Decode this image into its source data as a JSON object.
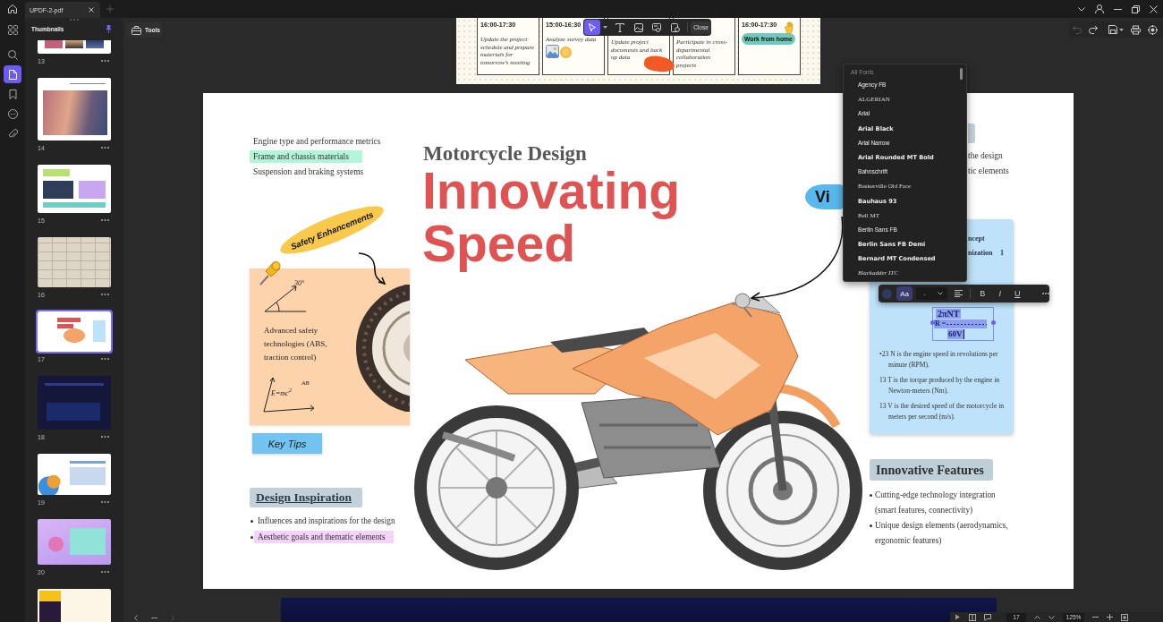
{
  "title_bar": {
    "tabs": [
      {
        "label": "UPDF-2-pdf",
        "selected": true
      }
    ]
  },
  "nav_rail": {
    "items": [
      {
        "selected": false
      },
      {
        "selected": false
      },
      {
        "selected": true
      },
      {
        "selected": false
      },
      {
        "selected": false
      },
      {
        "selected": false
      }
    ]
  },
  "thumbnails": {
    "title": "Thumbnails",
    "pinned": true,
    "pages": [
      {
        "number": "13",
        "selected": false
      },
      {
        "number": "14",
        "selected": false
      },
      {
        "number": "15",
        "selected": false
      },
      {
        "number": "16",
        "selected": false
      },
      {
        "number": "17",
        "selected": true
      },
      {
        "number": "18",
        "selected": false
      },
      {
        "number": "19",
        "selected": false
      },
      {
        "number": "20",
        "selected": false
      },
      {
        "selected": false
      }
    ]
  },
  "tools_button": {
    "label": "Tools"
  },
  "edit_toolbar": {
    "tools": [
      {
        "selected": true
      },
      {
        "selected": false
      },
      {
        "selected": false
      },
      {
        "selected": false
      },
      {
        "selected": false
      }
    ],
    "close": "Close"
  },
  "previous_page": {
    "cards": [
      {
        "time": "16:00-17:30",
        "text": "Update the project schedule and prepare materials for tomorrow's meeting"
      },
      {
        "time": "15:00-16:30",
        "text": "Analyze survey data"
      },
      {
        "text": "Update project documents and back up data"
      },
      {
        "text": "Participate in cross-departmental collaboration projects"
      },
      {
        "time": "16:00-17:30",
        "badge": "Work from home"
      }
    ]
  },
  "page": {
    "topics": [
      {
        "text": "Engine type and performance metrics",
        "highlighted": false
      },
      {
        "text": "Frame and chassis materials",
        "highlighted": true
      },
      {
        "text": "Suspension and braking systems",
        "highlighted": false
      }
    ],
    "subtitle": "Motorcycle Design",
    "title": [
      "Innovating",
      "Speed"
    ],
    "sticker": "Safety Enhancements",
    "note_card": {
      "angle": "30°",
      "text": "Advanced safety technologies (ABS, traction control)",
      "formula": "E=mc$^{2}$",
      "formula_note": "AB"
    },
    "tips_label": "Key Tips",
    "inspiration": {
      "heading": "Design Inspiration",
      "items": [
        {
          "text": "Influences and inspirations for the design",
          "highlighted": false
        },
        {
          "text": "Aesthetic goals and thematic elements",
          "highlighted": true
        }
      ]
    },
    "visual_sticker": "Vi",
    "right_column": {
      "lines": [
        "the design",
        "tic elements"
      ]
    },
    "formula_card": {
      "lines": [
        "ncept",
        "nization"
      ],
      "mark": "1",
      "equation": {
        "numerator": "2πNT",
        "lhs": "R =",
        "denominator": "60V"
      },
      "notes": [
        "•23 N is the engine speed in revolutions per minute (RPM).",
        "13 T is the torque produced by the engine in Newton-meters (Nm).",
        "13 V is the desired speed of the motorcycle in meters per second (m/s)."
      ]
    },
    "features": {
      "heading": "Innovative Features",
      "items": [
        "Cutting-edge technology integration (smart features, connectivity)",
        "Unique design elements (aerodynamics, ergonomic features)"
      ]
    }
  },
  "font_menu": {
    "header": "All Fonts",
    "fonts": [
      {
        "name": "Agency FB",
        "kind": "narrow"
      },
      {
        "name": "ALGERIAN",
        "kind": "serif"
      },
      {
        "name": "Arial",
        "kind": "sans"
      },
      {
        "name": "Arial Black",
        "kind": "bold"
      },
      {
        "name": "Arial Narrow",
        "kind": "narrow"
      },
      {
        "name": "Arial Rounded MT Bold",
        "kind": "bold"
      },
      {
        "name": "Bahnschrift",
        "kind": "sans"
      },
      {
        "name": "Baskerville Old Face",
        "kind": "serif"
      },
      {
        "name": "Bauhaus 93",
        "kind": "bold"
      },
      {
        "name": "Bell MT",
        "kind": "serif"
      },
      {
        "name": "Berlin Sans FB",
        "kind": "sans"
      },
      {
        "name": "Berlin Sans FB Demi",
        "kind": "bold"
      },
      {
        "name": "Bernard MT Condensed",
        "kind": "bold"
      },
      {
        "name": "Blackadder ITC",
        "kind": "script"
      }
    ]
  },
  "format_toolbar": {
    "case_button": {
      "label": "Aa",
      "selected": true
    },
    "size_select": {
      "value": "-"
    },
    "styles": [
      {
        "label": "B",
        "selected": false
      },
      {
        "label": "I",
        "selected": false
      },
      {
        "label": "U",
        "selected": false
      }
    ]
  },
  "status_bar": {
    "page": "17",
    "zoom": "125%"
  }
}
